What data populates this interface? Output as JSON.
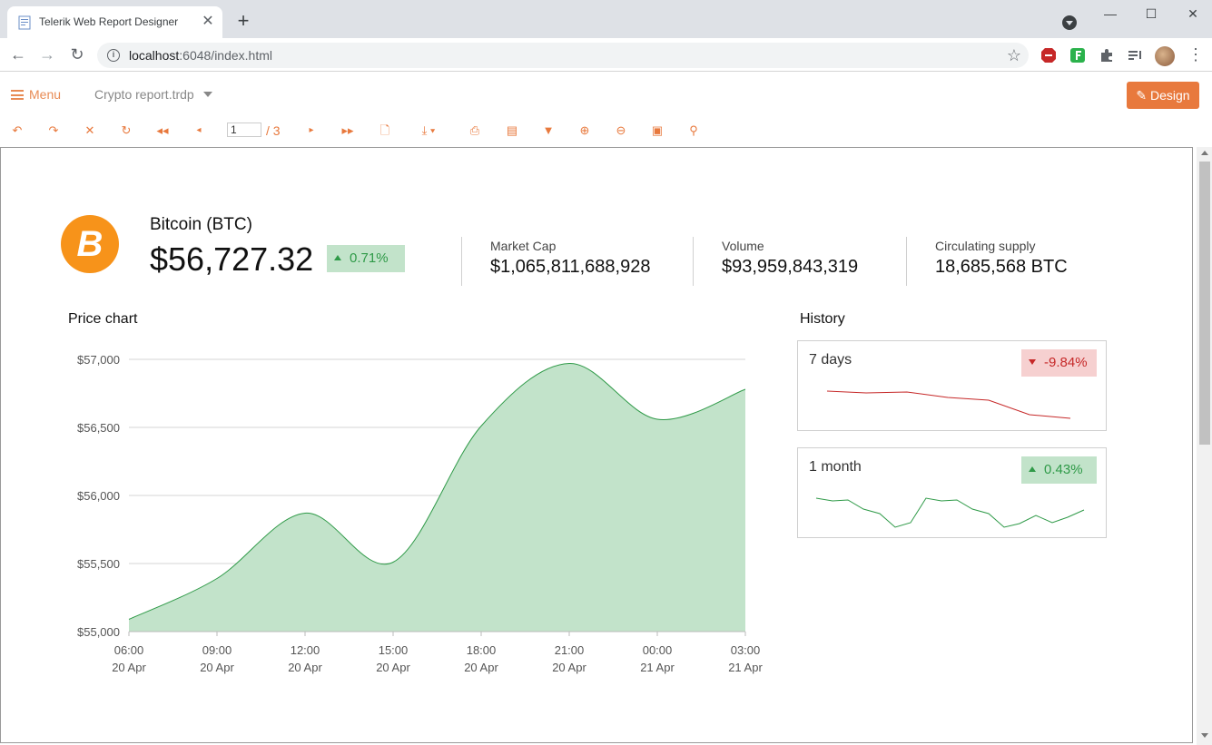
{
  "browser": {
    "tab_title": "Telerik Web Report Designer",
    "close_glyph": "✕",
    "new_tab_glyph": "+",
    "url_host": "localhost",
    "url_rest": ":6048/index.html",
    "window_buttons": [
      "—",
      "☐",
      "✕"
    ]
  },
  "viewer": {
    "menu_label": "Menu",
    "file_name": "Crypto report.trdp",
    "design_label": "Design",
    "page_current": "1",
    "page_total": "/ 3",
    "accent": "#e8793d"
  },
  "coin": {
    "logo_symbol": "B",
    "name": "Bitcoin (BTC)",
    "price": "$56,727.32",
    "change": "0.71%",
    "stats": [
      {
        "label": "Market Cap",
        "value": "$1,065,811,688,928"
      },
      {
        "label": "Volume",
        "value": "$93,959,843,319"
      },
      {
        "label": "Circulating supply",
        "value": "18,685,568 BTC"
      }
    ]
  },
  "sections": {
    "price_chart_title": "Price chart",
    "history_title": "History"
  },
  "history": [
    {
      "label": "7 days",
      "change": "-9.84%",
      "direction": "down",
      "color": "#c62828"
    },
    {
      "label": "1 month",
      "change": "0.43%",
      "direction": "up",
      "color": "#2f9a48"
    }
  ],
  "chart_data": {
    "type": "area",
    "title": "Price chart",
    "xlabel": "",
    "ylabel": "",
    "ylim": [
      55000,
      57000
    ],
    "yticks": [
      55000,
      55500,
      56000,
      56500,
      57000
    ],
    "ytick_labels": [
      "$55,000",
      "$55,500",
      "$56,000",
      "$56,500",
      "$57,000"
    ],
    "categories": [
      {
        "time": "06:00",
        "date": "20 Apr"
      },
      {
        "time": "09:00",
        "date": "20 Apr"
      },
      {
        "time": "12:00",
        "date": "20 Apr"
      },
      {
        "time": "15:00",
        "date": "20 Apr"
      },
      {
        "time": "18:00",
        "date": "20 Apr"
      },
      {
        "time": "21:00",
        "date": "20 Apr"
      },
      {
        "time": "00:00",
        "date": "21 Apr"
      },
      {
        "time": "03:00",
        "date": "21 Apr"
      }
    ],
    "values": [
      55090,
      55390,
      55870,
      55510,
      56510,
      56970,
      56560,
      56780
    ],
    "fill_color": "#c2e3ca",
    "line_color": "#2f9a48",
    "grid": true
  }
}
